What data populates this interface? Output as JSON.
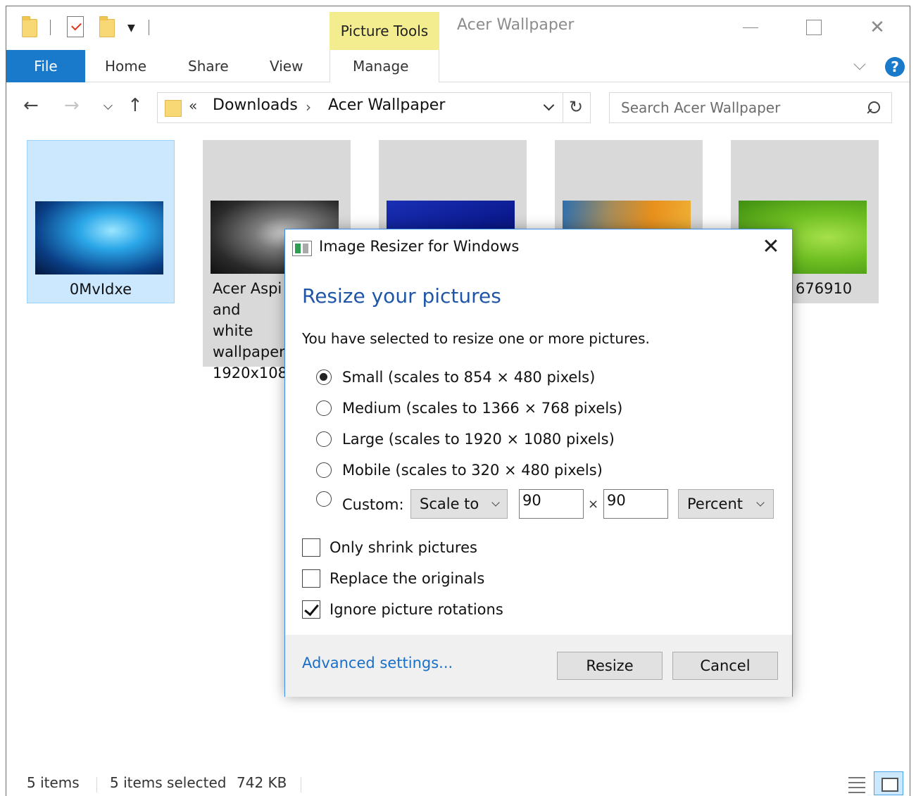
{
  "window": {
    "title": "Acer Wallpaper",
    "context_tab": "Picture Tools",
    "accent_color": "#1979ca",
    "context_color": "#f4ed8f"
  },
  "ribbon": {
    "tabs": [
      {
        "label": "File"
      },
      {
        "label": "Home"
      },
      {
        "label": "Share"
      },
      {
        "label": "View"
      },
      {
        "label": "Manage"
      }
    ],
    "help_glyph": "?"
  },
  "nav": {
    "back": "←",
    "forward": "→",
    "up": "↑",
    "breadcrumb_prefix": "«",
    "breadcrumbs": [
      "Downloads",
      "Acer Wallpaper"
    ],
    "breadcrumb_sep": "›",
    "refresh": "↻",
    "search_placeholder": "Search Acer Wallpaper"
  },
  "files": [
    {
      "label": "0MvIdxe",
      "selected": true
    },
    {
      "label": "Acer Aspi and white wallpaper 1920x1080",
      "selected": false
    },
    {
      "label": "",
      "selected": false
    },
    {
      "label": "",
      "selected": false
    },
    {
      "label": "676910",
      "selected": false
    }
  ],
  "status": {
    "item_count": "5 items",
    "selection": "5 items selected",
    "size": "742 KB"
  },
  "dialog": {
    "title": "Image Resizer for Windows",
    "close": "✕",
    "heading": "Resize your pictures",
    "description": "You have selected to resize one or more pictures.",
    "sizes": [
      {
        "label": "Small (scales to 854 × 480 pixels)",
        "selected": true
      },
      {
        "label": "Medium (scales to 1366 × 768 pixels)",
        "selected": false
      },
      {
        "label": "Large (scales to 1920 × 1080 pixels)",
        "selected": false
      },
      {
        "label": "Mobile (scales to 320 × 480 pixels)",
        "selected": false
      }
    ],
    "custom": {
      "label": "Custom:",
      "mode": "Scale to",
      "width": "90",
      "times": "×",
      "height": "90",
      "unit": "Percent"
    },
    "options": [
      {
        "label": "Only shrink pictures",
        "checked": false
      },
      {
        "label": "Replace the originals",
        "checked": false
      },
      {
        "label": "Ignore picture rotations",
        "checked": true
      }
    ],
    "advanced_link": "Advanced settings...",
    "resize_button": "Resize",
    "cancel_button": "Cancel"
  }
}
